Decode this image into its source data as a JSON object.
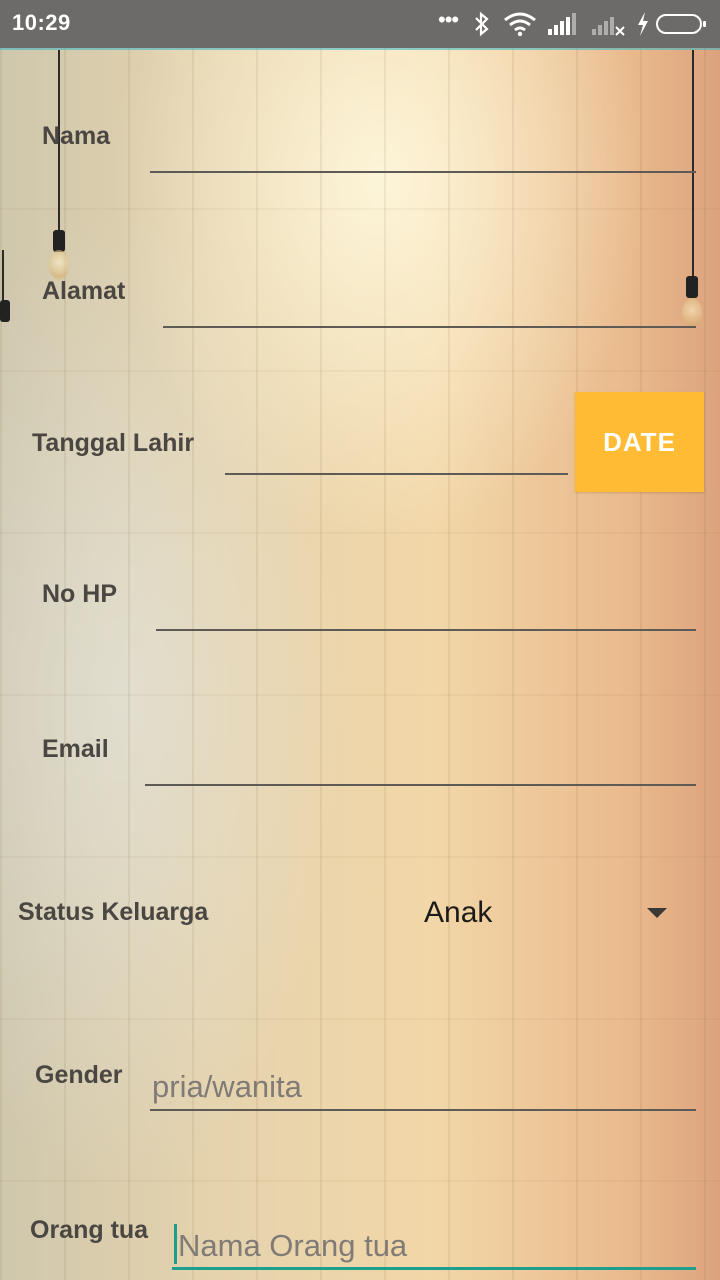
{
  "status_bar": {
    "time": "10:29",
    "icons": [
      "more-dots-icon",
      "bluetooth-icon",
      "wifi-icon",
      "signal-icon",
      "signal-no-sim-icon",
      "charging-icon",
      "battery-icon"
    ]
  },
  "form": {
    "nama": {
      "label": "Nama",
      "value": ""
    },
    "alamat": {
      "label": "Alamat",
      "value": ""
    },
    "tanggal_lahir": {
      "label": "Tanggal Lahir",
      "value": "",
      "button_label": "DATE"
    },
    "no_hp": {
      "label": "No HP",
      "value": ""
    },
    "email": {
      "label": "Email",
      "value": ""
    },
    "status_keluarga": {
      "label": "Status Keluarga",
      "selected": "Anak"
    },
    "gender": {
      "label": "Gender",
      "value": "",
      "placeholder": "pria/wanita"
    },
    "orang_tua": {
      "label": "Orang tua",
      "value": "",
      "placeholder": "Nama Orang tua"
    }
  },
  "colors": {
    "date_button": "#ffbb33",
    "focus_accent": "#1e9e8c",
    "status_bar": "#6d6b69"
  }
}
